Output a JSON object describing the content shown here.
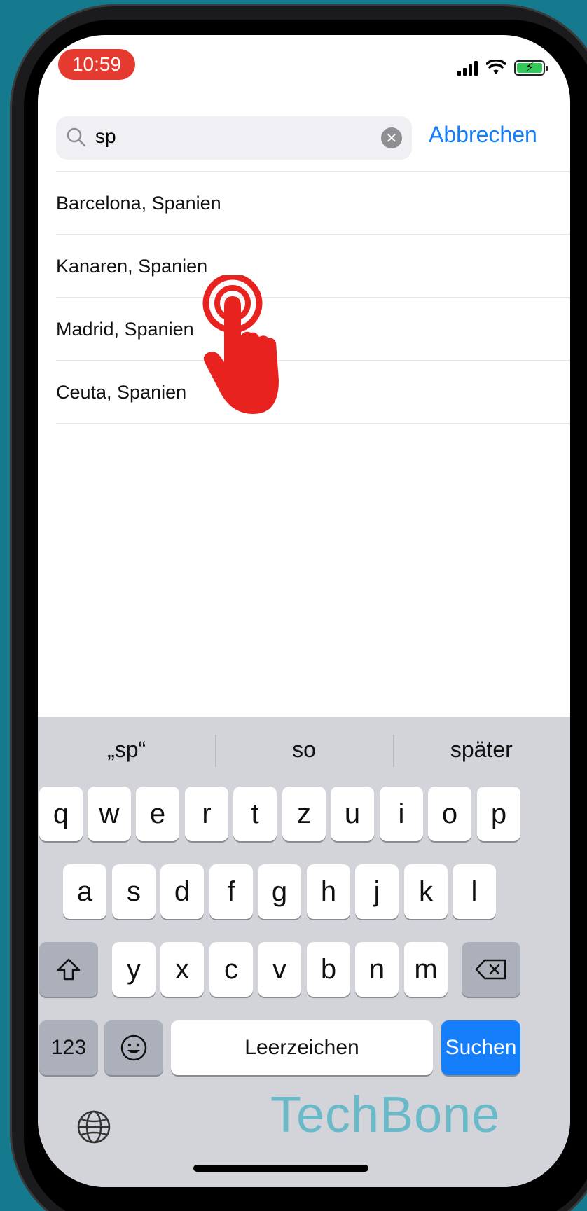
{
  "status_bar": {
    "time": "10:59"
  },
  "search": {
    "query": "sp",
    "cancel_label": "Abbrechen"
  },
  "results": [
    {
      "label": "Barcelona, Spanien"
    },
    {
      "label": "Kanaren, Spanien"
    },
    {
      "label": "Madrid, Spanien"
    },
    {
      "label": "Ceuta, Spanien"
    }
  ],
  "keyboard": {
    "suggestions": [
      "„sp“",
      "so",
      "später"
    ],
    "row1": [
      "q",
      "w",
      "e",
      "r",
      "t",
      "z",
      "u",
      "i",
      "o",
      "p"
    ],
    "row2": [
      "a",
      "s",
      "d",
      "f",
      "g",
      "h",
      "j",
      "k",
      "l"
    ],
    "row3": [
      "y",
      "x",
      "c",
      "v",
      "b",
      "n",
      "m"
    ],
    "numbers_label": "123",
    "space_label": "Leerzeichen",
    "search_label": "Suchen"
  },
  "watermark": "TechBone",
  "colors": {
    "accent": "#157efb",
    "time_pill": "#e53a2f",
    "tap_hand": "#e8231f",
    "background": "#167a8e"
  },
  "icons": {
    "search": "search-icon",
    "clear": "clear-icon",
    "shift": "shift-icon",
    "delete": "delete-icon",
    "emoji": "emoji-icon",
    "globe": "globe-icon",
    "tap_hand": "tap-hand-icon"
  }
}
